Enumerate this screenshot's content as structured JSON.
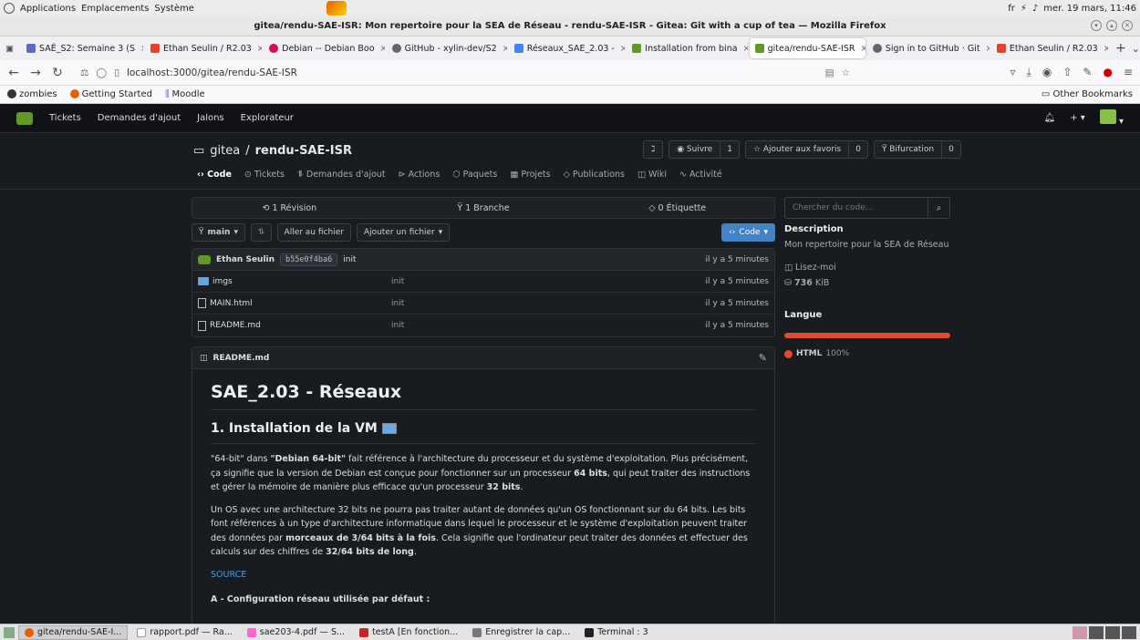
{
  "system": {
    "menus": [
      "Applications",
      "Emplacements",
      "Système"
    ],
    "lang": "fr",
    "datetime": "mer. 19 mars, 11:46"
  },
  "window": {
    "title": "gitea/rendu-SAE-ISR: Mon repertoire pour la SEA de Réseau - rendu-SAE-ISR - Gitea: Git with a cup of tea — Mozilla Firefox"
  },
  "tabs": [
    {
      "label": "SAÉ_S2: Semaine 3 (S",
      "color": "#5c6bc0"
    },
    {
      "label": "Ethan Seulin / R2.03",
      "color": "#e24329"
    },
    {
      "label": "Debian -- Debian Boo",
      "color": "#d70a53"
    },
    {
      "label": "GitHub - xylin-dev/S2",
      "color": "#666666"
    },
    {
      "label": "Réseaux_SAE_2.03 -",
      "color": "#4285f4"
    },
    {
      "label": "Installation from bina",
      "color": "#609926"
    },
    {
      "label": "gitea/rendu-SAE-ISR",
      "color": "#609926",
      "active": true
    },
    {
      "label": "Sign in to GitHub · Git",
      "color": "#666666"
    },
    {
      "label": "Ethan Seulin / R2.03",
      "color": "#e24329"
    }
  ],
  "url": "localhost:3000/gitea/rendu-SAE-ISR",
  "bookmarks": {
    "items": [
      "zombies",
      "Getting Started",
      "Moodle"
    ],
    "other": "Other Bookmarks"
  },
  "gitea_nav": {
    "items": [
      "Tickets",
      "Demandes d'ajout",
      "Jalons",
      "Explorateur"
    ]
  },
  "repo": {
    "owner": "gitea",
    "name": "rendu-SAE-ISR",
    "actions": [
      {
        "label": "Suivre",
        "count": "1"
      },
      {
        "label": "Ajouter aux favoris",
        "count": "0"
      },
      {
        "label": "Bifurcation",
        "count": "0"
      }
    ],
    "tabs": [
      "Code",
      "Tickets",
      "Demandes d'ajout",
      "Actions",
      "Paquets",
      "Projets",
      "Publications",
      "Wiki",
      "Activité"
    ]
  },
  "stats": {
    "commits": "1 Révision",
    "branches": "1 Branche",
    "tags": "0 Étiquette"
  },
  "branchbar": {
    "branch": "main",
    "goto_file": "Aller au fichier",
    "add_file": "Ajouter un fichier",
    "code": "Code"
  },
  "commit": {
    "author": "Ethan Seulin",
    "sha": "b55e0f4ba6",
    "message": "init",
    "time": "il y a 5 minutes"
  },
  "files": [
    {
      "name": "imgs",
      "type": "folder",
      "message": "init",
      "time": "il y a 5 minutes"
    },
    {
      "name": "MAIN.html",
      "type": "file",
      "message": "init",
      "time": "il y a 5 minutes"
    },
    {
      "name": "README.md",
      "type": "file",
      "message": "init",
      "time": "il y a 5 minutes"
    }
  ],
  "readme": {
    "filename": "README.md",
    "h1": "SAE_2.03 - Réseaux",
    "h2": "1. Installation de la VM",
    "p1_a": "\"64-bit\" dans ",
    "p1_b": "\"Debian 64-bit\"",
    "p1_c": " fait référence à l'architecture du processeur et du système d'exploitation. Plus précisément, ça signifie que la version de Debian est conçue pour fonctionner sur un processeur ",
    "p1_d": "64 bits",
    "p1_e": ", qui peut traiter des instructions et gérer la mémoire de manière plus efficace qu'un processeur ",
    "p1_f": "32 bits",
    "p1_g": ".",
    "p2_a": "Un OS avec une architecture 32 bits ne pourra pas traiter autant de données qu'un OS fonctionnant sur du 64 bits. Les bits font références à un type d'architecture informatique dans lequel le processeur et le système d'exploitation peuvent traiter des données par ",
    "p2_b": "morceaux de 3/64 bits à la fois",
    "p2_c": ". Cela signifie que l'ordinateur peut traiter des données et effectuer des calculs sur des chiffres de ",
    "p2_d": "32/64 bits de long",
    "p2_e": ".",
    "source": "SOURCE",
    "h4": "A - Configuration réseau utilisée par défaut :"
  },
  "sidebar": {
    "search_placeholder": "Chercher du code…",
    "desc_title": "Description",
    "desc": "Mon repertoire pour la SEA de Réseau",
    "readme_link": "Lisez-moi",
    "size": "736",
    "size_unit": "KiB",
    "lang_title": "Langue",
    "lang_name": "HTML",
    "lang_pct": "100%"
  },
  "taskbar": [
    {
      "label": "gitea/rendu-SAE-I...",
      "active": true
    },
    {
      "label": "rapport.pdf — Ra..."
    },
    {
      "label": "sae203-4.pdf — S..."
    },
    {
      "label": "testA [En fonction..."
    },
    {
      "label": "Enregistrer la cap..."
    },
    {
      "label": "Terminal : 3"
    }
  ]
}
